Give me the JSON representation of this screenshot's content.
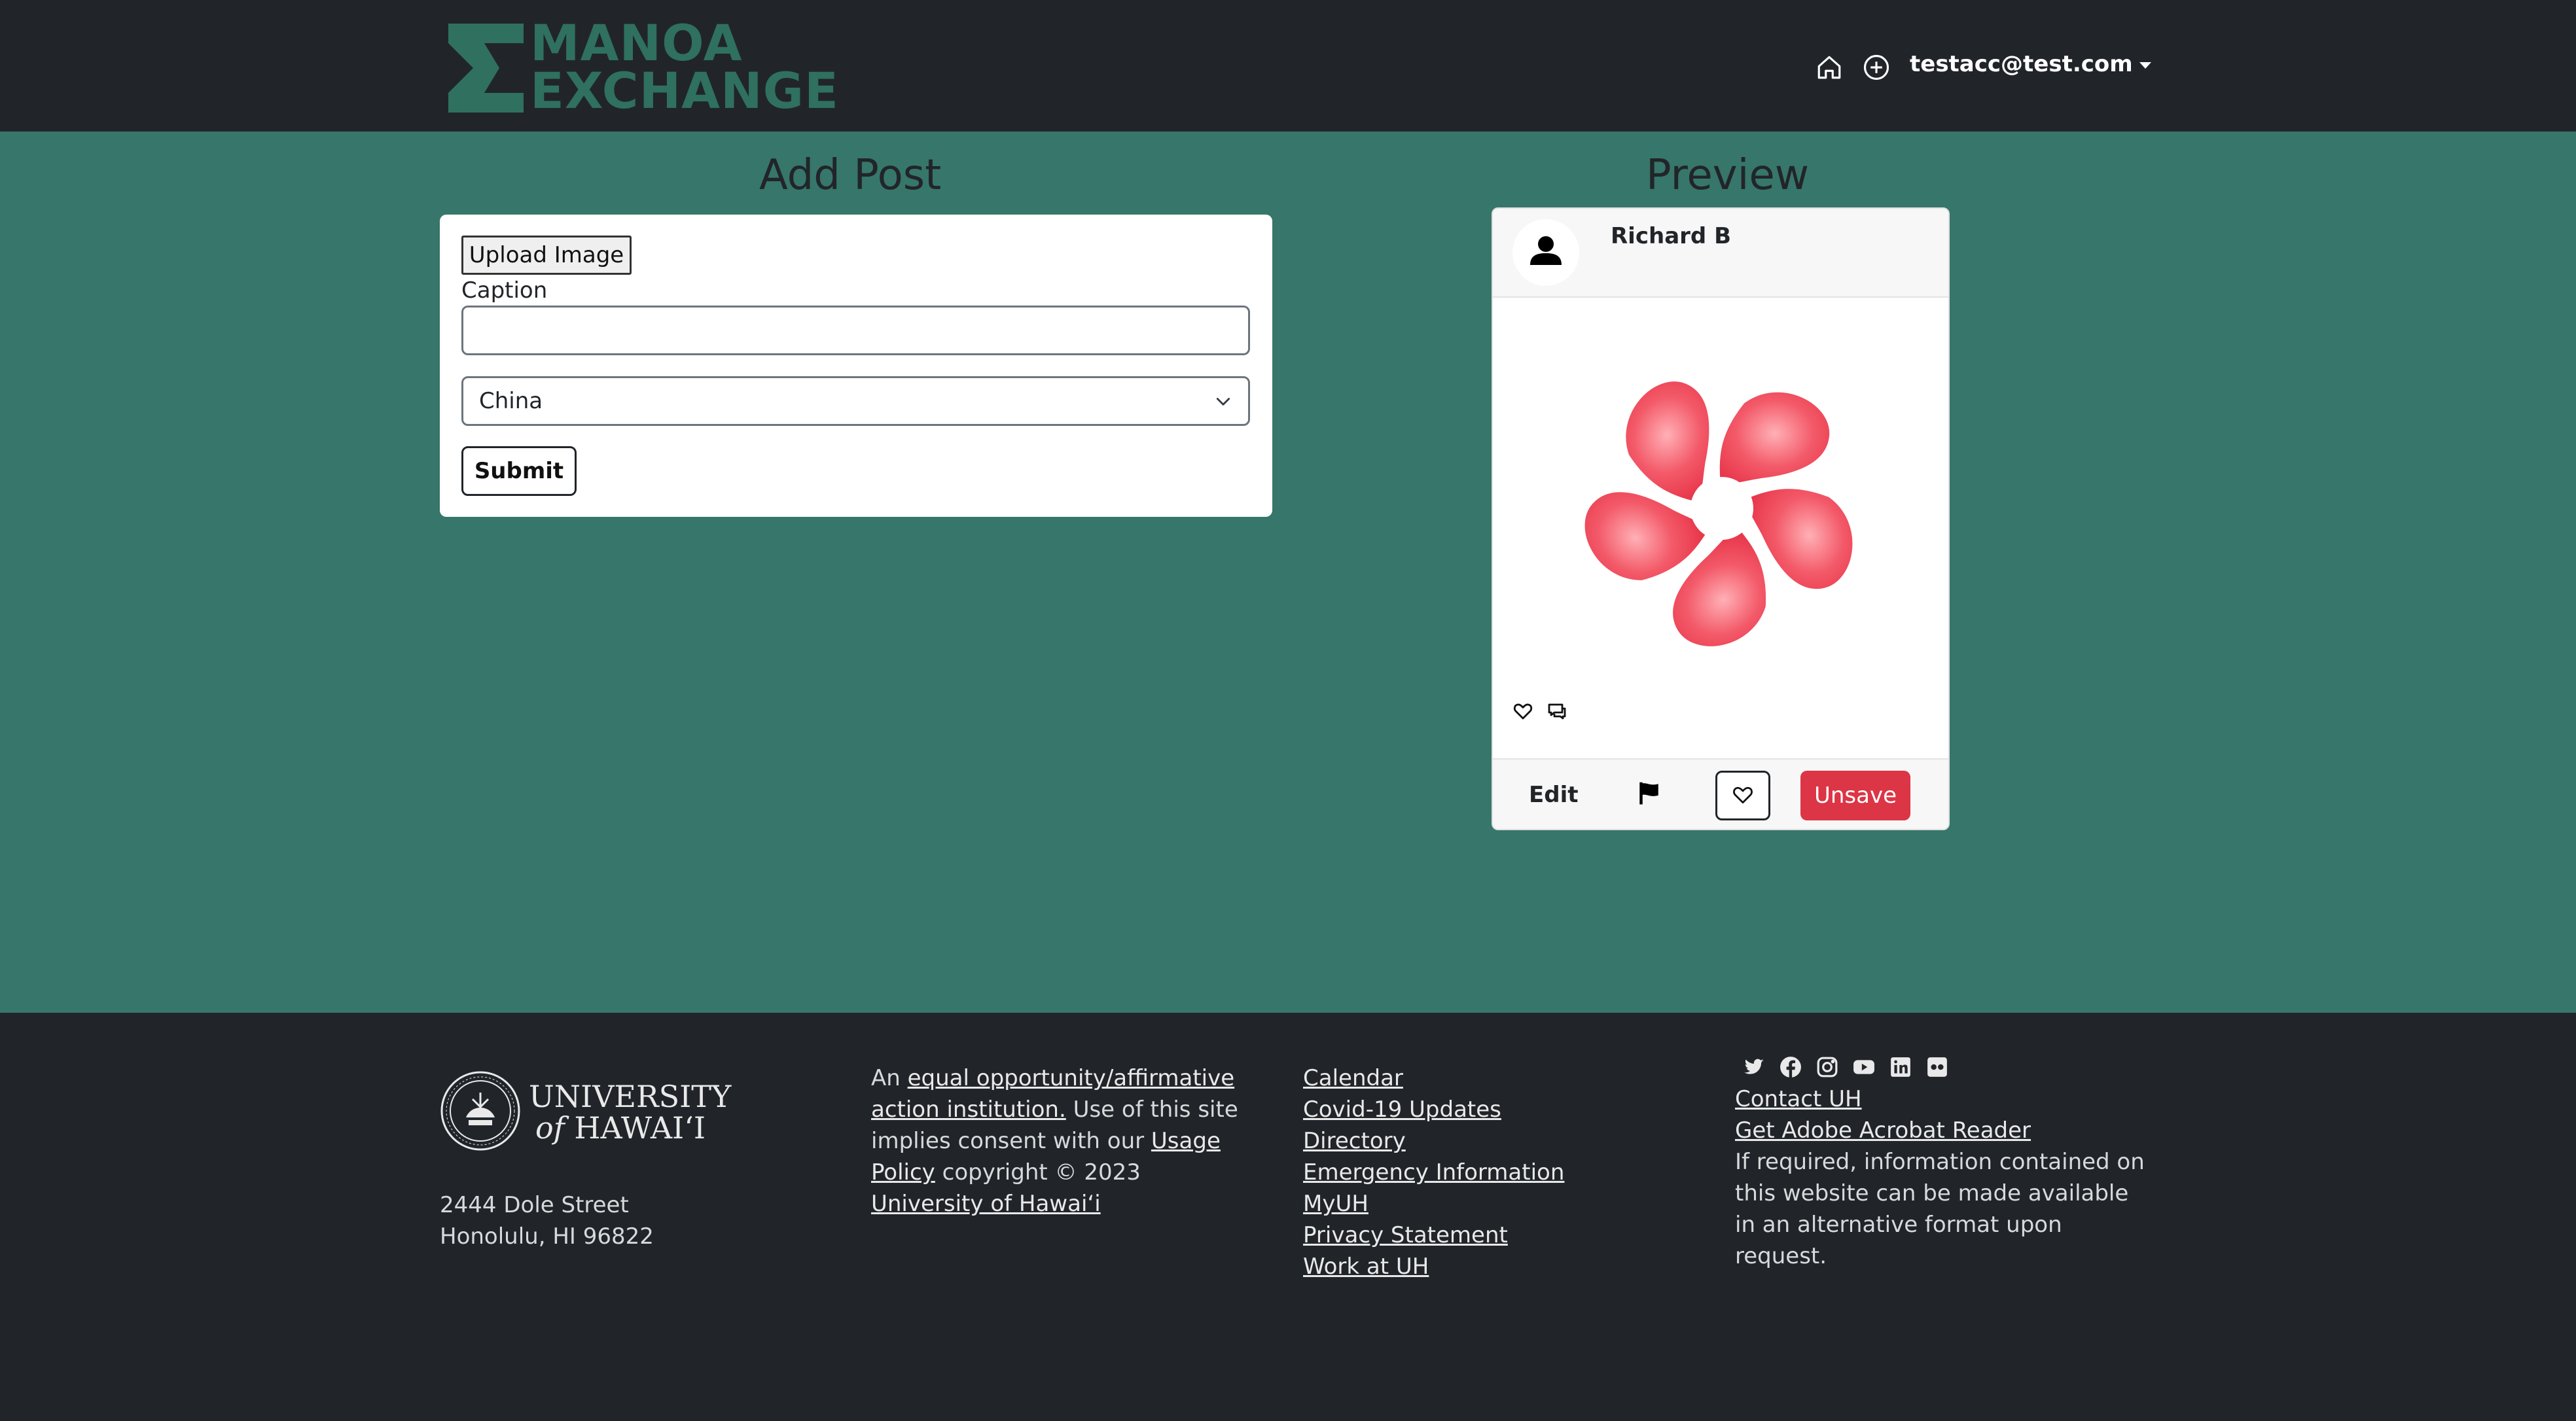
{
  "nav": {
    "logo_line1": "MANOA",
    "logo_line2": "EXCHANGE",
    "user": "testacc@test.com"
  },
  "form": {
    "title": "Add Post",
    "upload_label": "Upload Image",
    "caption_label": "Caption",
    "caption_value": "",
    "country_selected": "China",
    "submit_label": "Submit"
  },
  "preview": {
    "title": "Preview",
    "author": "Richard B",
    "edit_label": "Edit",
    "unsave_label": "Unsave"
  },
  "footer": {
    "uh_line1": "UNIVERSITY",
    "uh_line2_a": "of",
    "uh_line2_b": "HAWAI‘I",
    "address_line1": "2444 Dole Street",
    "address_line2": "Honolulu, HI 96822",
    "eo_prefix": "An ",
    "eo_link": "equal opportunity/affirmative action institution.",
    "eo_mid": " Use of this site implies consent with our ",
    "usage_link": "Usage Policy",
    "copyright": " copyright © 2023",
    "uh_link": "University of Hawaiʻi",
    "links": [
      "Calendar",
      "Covid-19 Updates",
      "Directory",
      "Emergency Information",
      "MyUH",
      "Privacy Statement",
      "Work at UH"
    ],
    "contact_link": "Contact UH",
    "adobe_link": "Get Adobe Acrobat Reader",
    "accessibility_note": "If required, information contained on this website can be made available in an alternative format upon request."
  },
  "colors": {
    "nav_bg": "#21252a",
    "main_bg": "#37766a",
    "brand_green": "#2f705f",
    "danger": "#dc3545",
    "flower": "#f2505f"
  },
  "icons": [
    "home-icon",
    "plus-circle-icon",
    "user-icon",
    "heart-icon",
    "comment-icon",
    "flag-icon",
    "twitter-icon",
    "facebook-icon",
    "instagram-icon",
    "youtube-icon",
    "linkedin-icon",
    "flickr-icon"
  ]
}
